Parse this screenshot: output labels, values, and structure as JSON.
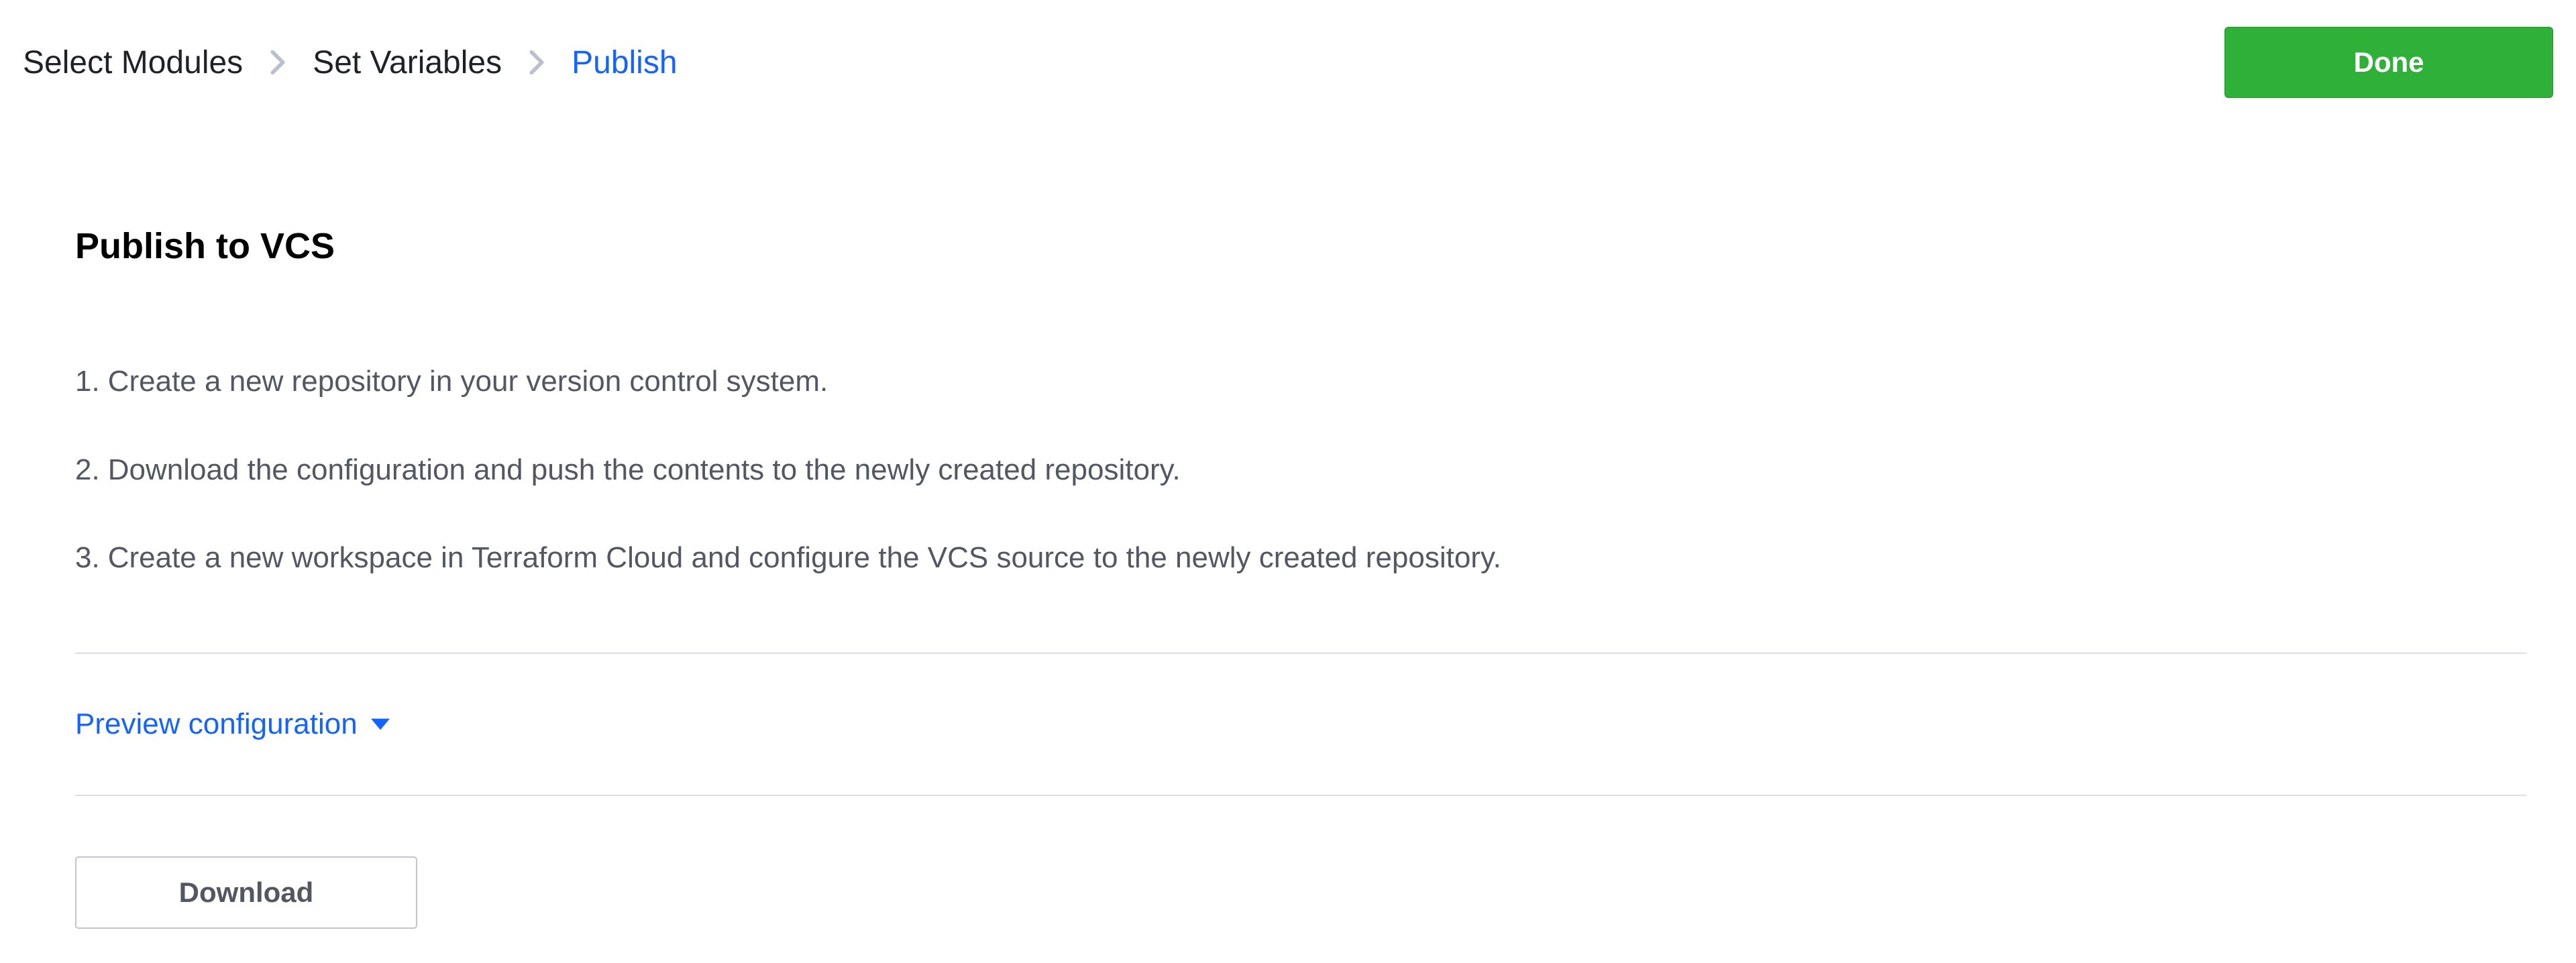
{
  "breadcrumb": {
    "items": [
      {
        "label": "Select Modules",
        "active": false
      },
      {
        "label": "Set Variables",
        "active": false
      },
      {
        "label": "Publish",
        "active": true
      }
    ]
  },
  "buttons": {
    "done": "Done",
    "download": "Download"
  },
  "section": {
    "title": "Publish to VCS"
  },
  "steps": [
    {
      "num": "1.",
      "text": "Create a new repository in your version control system."
    },
    {
      "num": "2.",
      "text": "Download the configuration and push the contents to the newly created repository."
    },
    {
      "num": "3.",
      "text": "Create a new workspace in Terraform Cloud and configure the VCS source to the newly created repository."
    }
  ],
  "preview": {
    "label": "Preview configuration"
  }
}
